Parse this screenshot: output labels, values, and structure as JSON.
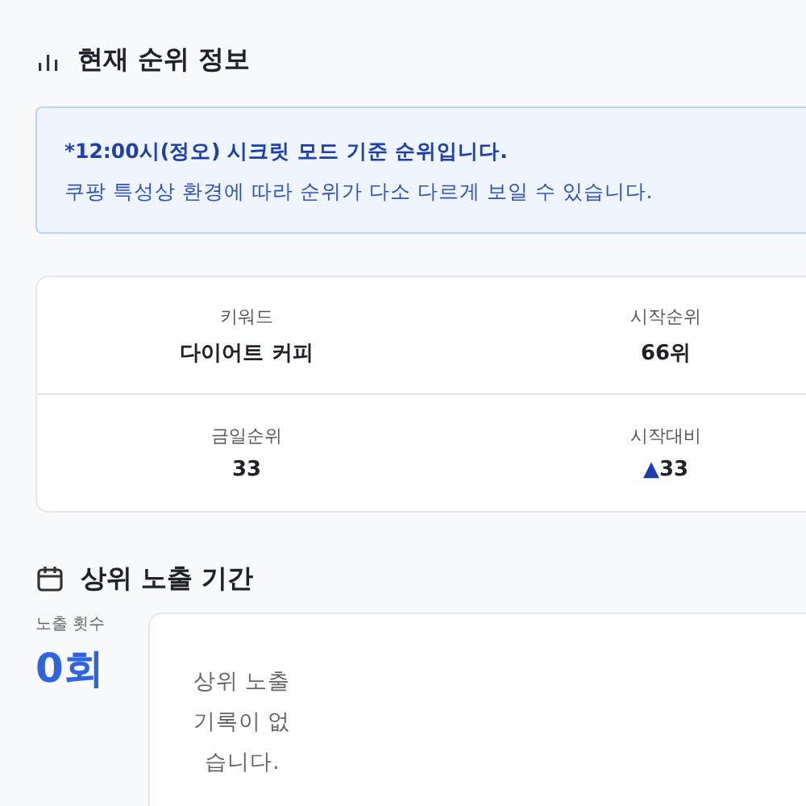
{
  "rank_section": {
    "title": "현재 순위 정보"
  },
  "notice": {
    "headline": "*12:00시(정오) 시크릿 모드 기준 순위입니다.",
    "body": "쿠팡 특성상 환경에 따라 순위가 다소 다르게 보일 수 있습니다."
  },
  "stats": [
    {
      "kind": "plain",
      "label": "키워드",
      "value": "다이어트 커피"
    },
    {
      "kind": "plain",
      "label": "시작순위",
      "value": "66위"
    },
    {
      "kind": "plain",
      "label": "금일순위",
      "value": "33"
    },
    {
      "kind": "change",
      "label": "시작대비",
      "arrow": "▲",
      "value": "33"
    }
  ],
  "exposure_section": {
    "title": "상위 노출 기간",
    "count_label": "노출 횟수",
    "count": "0회",
    "empty_message": "상위 노출 기록이 없습니다."
  }
}
